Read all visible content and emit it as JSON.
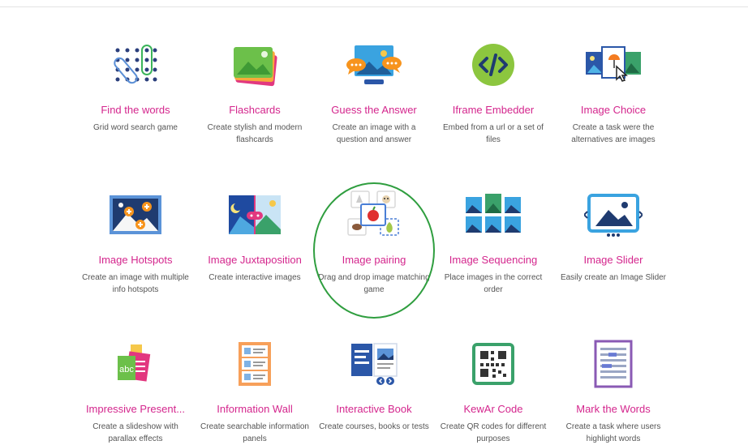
{
  "content_types": [
    {
      "title": "Find the words",
      "description": "Grid word search game",
      "icon": "word-grid-icon"
    },
    {
      "title": "Flashcards",
      "description": "Create stylish and modern flashcards",
      "icon": "flashcards-icon"
    },
    {
      "title": "Guess the Answer",
      "description": "Create an image with a question and answer",
      "icon": "guess-answer-icon"
    },
    {
      "title": "Iframe Embedder",
      "description": "Embed from a url or a set of files",
      "icon": "code-icon"
    },
    {
      "title": "Image Choice",
      "description": "Create a task were the alternatives are images",
      "icon": "image-choice-icon"
    },
    {
      "title": "Image Hotspots",
      "description": "Create an image with multiple info hotspots",
      "icon": "hotspots-icon"
    },
    {
      "title": "Image Juxtaposition",
      "description": "Create interactive images",
      "icon": "juxtaposition-icon"
    },
    {
      "title": "Image pairing",
      "description": "Drag and drop image matching game",
      "icon": "image-pairing-icon"
    },
    {
      "title": "Image Sequencing",
      "description": "Place images in the correct order",
      "icon": "sequencing-icon"
    },
    {
      "title": "Image Slider",
      "description": "Easily create an Image Slider",
      "icon": "image-slider-icon"
    },
    {
      "title": "Impressive Present...",
      "description": "Create a slideshow with parallax effects",
      "icon": "presentation-icon"
    },
    {
      "title": "Information Wall",
      "description": "Create searchable information panels",
      "icon": "information-wall-icon"
    },
    {
      "title": "Interactive Book",
      "description": "Create courses, books or tests",
      "icon": "book-icon"
    },
    {
      "title": "KewAr Code",
      "description": "Create QR codes for different purposes",
      "icon": "qr-code-icon"
    },
    {
      "title": "Mark the Words",
      "description": "Create a task where users highlight words",
      "icon": "mark-words-icon"
    }
  ],
  "highlight_color": "#2f9e3f",
  "title_color": "#d4268d"
}
